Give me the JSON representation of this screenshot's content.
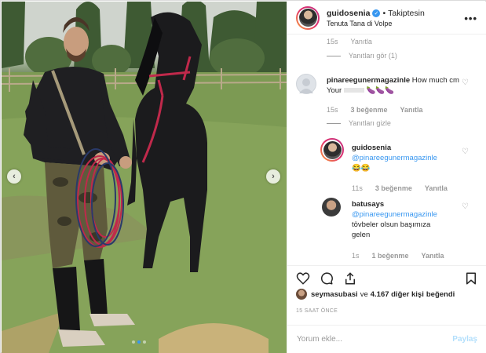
{
  "post": {
    "username": "guidosenia",
    "separator": "•",
    "follow_status": "Takiptesin",
    "location": "Tenuta Tana di Volpe",
    "more_icon": "more-horizontal-icon"
  },
  "comments": {
    "top_meta": {
      "time": "15s",
      "reply": "Yanıtla"
    },
    "view_replies": "Yanıtları gör (1)",
    "c1": {
      "username": "pinareegunermagazinle",
      "text": "How much cm Your",
      "emoji": "🍆🍆🍆",
      "time": "15s",
      "likes": "3 beğenme",
      "reply": "Yanıtla",
      "hide_replies": "Yanıtları gizle"
    },
    "r1": {
      "username": "guidosenia",
      "mention": "@pinareegunermagazinle",
      "emoji": "😂😂",
      "time": "11s",
      "likes": "3 beğenme",
      "reply": "Yanıtla"
    },
    "r2": {
      "username": "batusays",
      "mention": "@pinareegunermagazinle",
      "text1": "tövbeler olsun başımıza",
      "text2": "gelen",
      "time": "1s",
      "likes": "1 beğenme",
      "reply": "Yanıtla"
    }
  },
  "actions": {
    "icons": [
      "heart-icon",
      "comment-icon",
      "share-icon",
      "bookmark-icon"
    ]
  },
  "likes": {
    "user": "seymasubasi",
    "conj": "ve",
    "count": "4.167 diğer kişi",
    "suffix": "beğendi"
  },
  "timestamp": "15 SAAT ÖNCE",
  "add_comment": {
    "placeholder": "Yorum ekle...",
    "post_label": "Paylaş"
  },
  "colors": {
    "accent": "#3897f0",
    "story_ring": "#e1306c",
    "muted": "#999999"
  }
}
